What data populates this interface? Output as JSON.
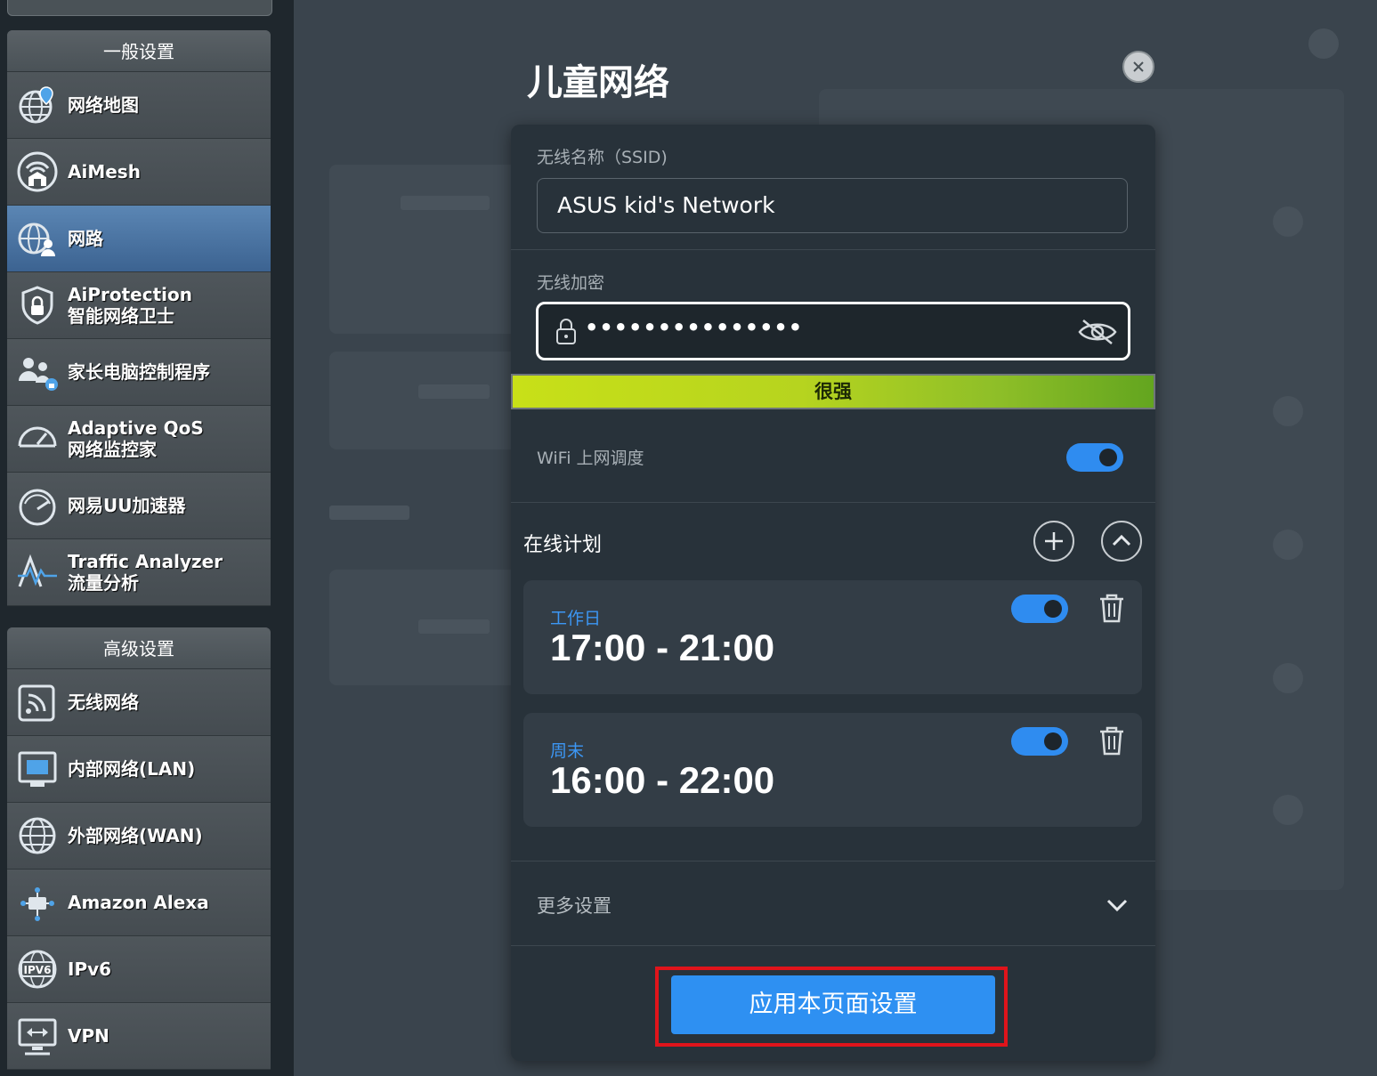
{
  "sidebar": {
    "general_header": "一般设置",
    "general_items": [
      {
        "label": "网络地图",
        "icon": "globe-map-icon"
      },
      {
        "label": "AiMesh",
        "icon": "aimesh-icon"
      },
      {
        "label": "网路",
        "icon": "network-guest-icon",
        "active": true
      },
      {
        "label": "AiProtection\n智能网络卫士",
        "icon": "shield-lock-icon"
      },
      {
        "label": "家长电脑控制程序",
        "icon": "parental-control-icon"
      },
      {
        "label": "Adaptive QoS\n网络监控家",
        "icon": "speedometer-icon"
      },
      {
        "label": "网易UU加速器",
        "icon": "gauge-icon"
      },
      {
        "label": "Traffic Analyzer\n流量分析",
        "icon": "traffic-pulse-icon"
      }
    ],
    "advanced_header": "高级设置",
    "advanced_items": [
      {
        "label": "无线网络",
        "icon": "wireless-icon"
      },
      {
        "label": "内部网络(LAN)",
        "icon": "lan-icon"
      },
      {
        "label": "外部网络(WAN)",
        "icon": "wan-globe-icon"
      },
      {
        "label": "Amazon Alexa",
        "icon": "alexa-icon"
      },
      {
        "label": "IPv6",
        "icon": "ipv6-icon"
      },
      {
        "label": "VPN",
        "icon": "vpn-icon"
      }
    ]
  },
  "modal": {
    "title": "儿童网络",
    "ssid_label": "无线名称（SSID)",
    "ssid_value": "ASUS kid's Network",
    "password_label": "无线加密",
    "password_value": "•••••••••••••••",
    "strength_text": "很强",
    "wifi_schedule_label": "WiFi 上网调度",
    "wifi_schedule_on": true,
    "online_plan_title": "在线计划",
    "schedules": [
      {
        "name": "工作日",
        "time": "17:00 - 21:00",
        "enabled": true
      },
      {
        "name": "周末",
        "time": "16:00 - 22:00",
        "enabled": true
      }
    ],
    "more_settings_label": "更多设置",
    "apply_button": "应用本页面设置"
  },
  "colors": {
    "accent": "#2e90f2",
    "schedule_name": "#3c97f5",
    "highlight_border": "#e0141b",
    "strength_start": "#c8e018",
    "strength_end": "#63a51f"
  }
}
